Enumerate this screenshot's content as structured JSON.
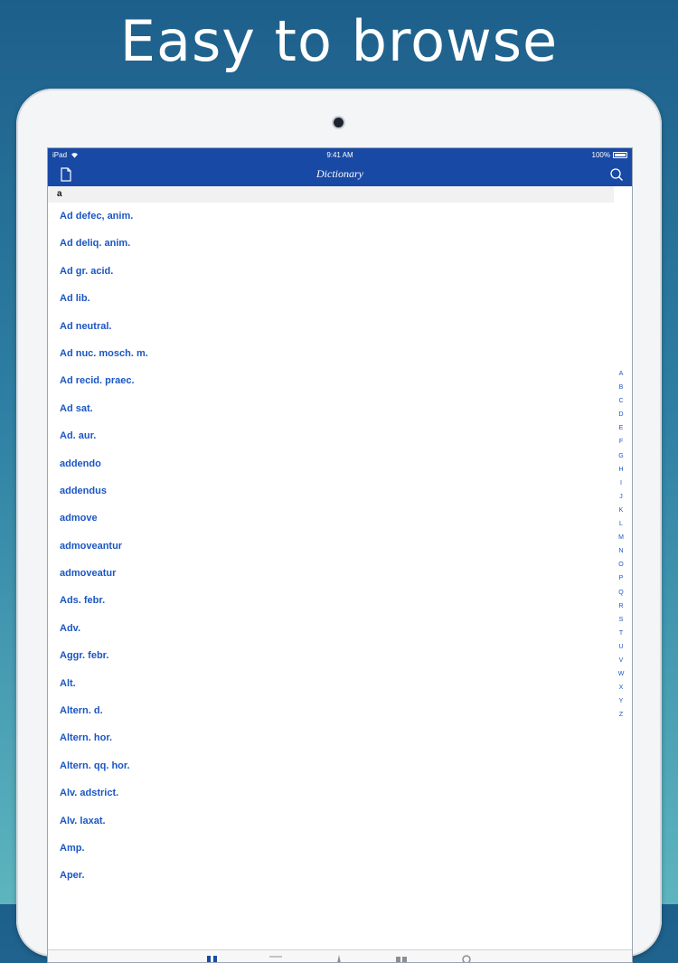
{
  "headline": "Easy to browse",
  "status_bar": {
    "device": "iPad",
    "time": "9:41 AM",
    "battery": "100%"
  },
  "nav": {
    "title": "Dictionary",
    "left_icon": "document-icon",
    "right_icon": "search-icon"
  },
  "section_header": "a",
  "entries": [
    "Ad defec, anim.",
    "Ad deliq. anim.",
    "Ad gr. acid.",
    "Ad lib.",
    "Ad neutral.",
    "Ad nuc. mosch. m.",
    "Ad recid. praec.",
    "Ad sat.",
    "Ad. aur.",
    "addendo",
    "addendus",
    "admove",
    "admoveantur",
    "admoveatur",
    "Ads. febr.",
    "Adv.",
    "Aggr. febr.",
    "Alt.",
    "Altern. d.",
    "Altern. hor.",
    "Altern. qq. hor.",
    "Alv. adstrict.",
    "Alv. laxat.",
    "Amp.",
    "Aper."
  ],
  "index_letters": [
    "A",
    "B",
    "C",
    "D",
    "E",
    "F",
    "G",
    "H",
    "I",
    "J",
    "K",
    "L",
    "M",
    "N",
    "O",
    "P",
    "Q",
    "R",
    "S",
    "T",
    "U",
    "V",
    "W",
    "X",
    "Y",
    "Z"
  ],
  "tab_icons": [
    "dictionary-tab-icon",
    "list-tab-icon",
    "pin-tab-icon",
    "book-tab-icon",
    "settings-tab-icon"
  ],
  "colors": {
    "accent": "#1849a5",
    "entry_text": "#1a56c4"
  }
}
